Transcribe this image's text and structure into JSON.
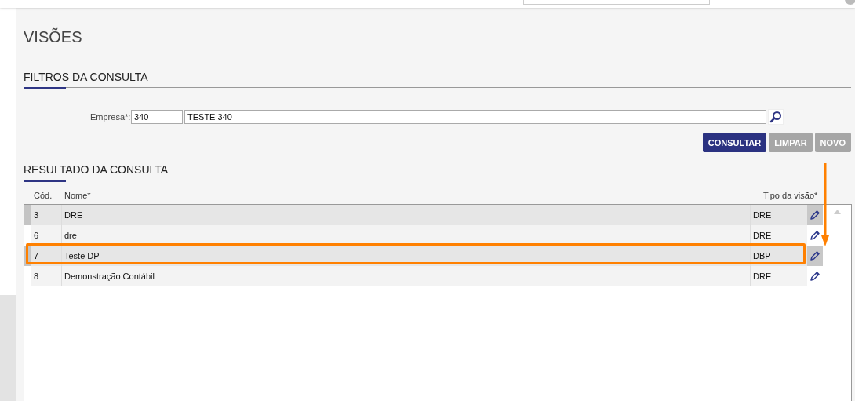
{
  "page": {
    "title": "VISÕES"
  },
  "filters": {
    "heading": "FILTROS DA CONSULTA",
    "label": "Empresa*:",
    "code": "340",
    "name": "TESTE 340"
  },
  "buttons": [
    {
      "label": "CONSULTAR",
      "kind": "primary"
    },
    {
      "label": "LIMPAR",
      "kind": "secondary"
    },
    {
      "label": "NOVO",
      "kind": "secondary"
    }
  ],
  "results": {
    "heading": "RESULTADO DA CONSULTA",
    "columns": [
      "Cód.",
      "Nome*",
      "Tipo da visão*"
    ],
    "rows": [
      {
        "code": "3",
        "name": "DRE",
        "type": "DRE",
        "highlighted": false
      },
      {
        "code": "6",
        "name": "dre",
        "type": "DRE",
        "highlighted": false
      },
      {
        "code": "7",
        "name": "Teste DP",
        "type": "DBP",
        "highlighted": true
      },
      {
        "code": "8",
        "name": "Demonstração Contábil",
        "type": "DRE",
        "highlighted": false
      }
    ]
  }
}
